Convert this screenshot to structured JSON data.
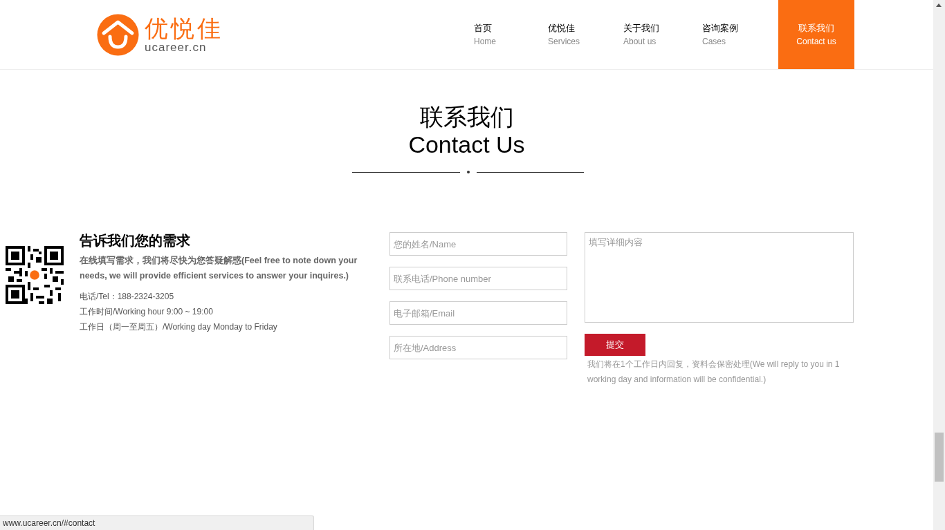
{
  "logo": {
    "name": "优悦佳",
    "domain": "ucareer.cn"
  },
  "nav": [
    {
      "label": "首页",
      "sublabel": "Home",
      "selected": false
    },
    {
      "label": "优悦佳",
      "sublabel": "Services",
      "selected": false
    },
    {
      "label": "关于我们",
      "sublabel": "About us",
      "selected": false
    },
    {
      "label": "咨询案例",
      "sublabel": "Cases",
      "selected": false
    },
    {
      "label": "联系我们",
      "sublabel": "Contact us",
      "selected": true
    }
  ],
  "section": {
    "title": "联系我们",
    "subtitle": "Contact Us"
  },
  "info": {
    "heading": "告诉我们您的需求",
    "intro": "在线填写需求，我们将尽快为您答疑解惑(Feel free to note down your needs, we will provide efficient services to answer your inquires.)",
    "lines": [
      "电话/Tel：188-2324-3205",
      "工作时间/Working hour 9:00 ~ 19:00",
      "工作日（周一至周五）/Working day Monday to Friday"
    ]
  },
  "form": {
    "fields": [
      {
        "placeholder": "您的姓名/Name"
      },
      {
        "placeholder": "联系电话/Phone number"
      },
      {
        "placeholder": "电子邮箱/Email"
      },
      {
        "placeholder": "所在地/Address"
      }
    ],
    "details": {
      "placeholder": "填写详细内容"
    },
    "submit": "提交",
    "note": "我们将在1个工作日内回复，资料会保密处理(We will reply to you in 1 working day and information will be confidential.)"
  },
  "status_bar": {
    "url": "www.ucareer.cn/#contact"
  }
}
